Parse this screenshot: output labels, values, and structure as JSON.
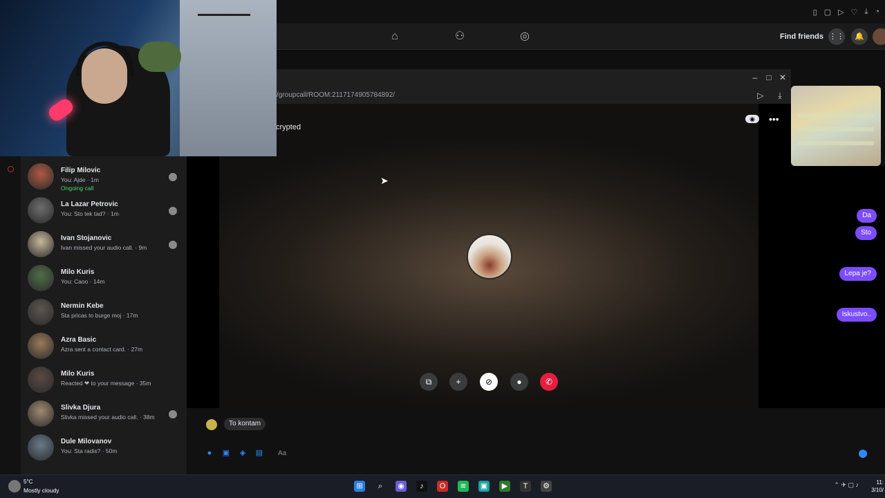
{
  "browser": {
    "url_fragment": "/groupcall/ROOM:2117174905784892/"
  },
  "fb_nav": {
    "find_friends_label": "Find friends"
  },
  "call": {
    "encryption_label": "crypted",
    "controls": [
      {
        "name": "share-screen-button",
        "glyph": "⧉"
      },
      {
        "name": "add-person-button",
        "glyph": "👤"
      },
      {
        "name": "video-off-button",
        "glyph": "⊘"
      },
      {
        "name": "microphone-button",
        "glyph": "🎤"
      },
      {
        "name": "end-call-button",
        "glyph": "✆"
      }
    ]
  },
  "chat_list": [
    {
      "name": "Filip Milovic",
      "preview": "You: Ajde · 1m",
      "extra": "Ongoing call",
      "avatar_color": "#b05a44"
    },
    {
      "name": "La Lazar Petrovic",
      "preview": "You: Sto tek tad? · 1m",
      "extra": "",
      "avatar_color": "#6d6d6d"
    },
    {
      "name": "Ivan Stojanovic",
      "preview": "Ivan missed your audio call. · 9m",
      "extra": "",
      "avatar_color": "#c8b79a"
    },
    {
      "name": "Milo Kuris",
      "preview": "You: Caoo · 14m",
      "extra": "",
      "avatar_color": "#4f6e48"
    },
    {
      "name": "Nermin Kebe",
      "preview": "Sta pricas to burge moj · 17m",
      "extra": "",
      "avatar_color": "#5d5550"
    },
    {
      "name": "Azra Basic",
      "preview": "Azra sent a contact card. · 27m",
      "extra": "",
      "avatar_color": "#9a7a5a"
    },
    {
      "name": "Milo Kuris",
      "preview": "Reacted ❤ to your message · 35m",
      "extra": "",
      "avatar_color": "#5a4a42"
    },
    {
      "name": "Slivka Djura",
      "preview": "Slivka missed your audio call. · 38m",
      "extra": "",
      "avatar_color": "#a08a70"
    },
    {
      "name": "Dule Milovanov",
      "preview": "You: Sta radis? · 50m",
      "extra": "",
      "avatar_color": "#6a7a8a"
    }
  ],
  "right_chat": {
    "bubbles": [
      "Da",
      "Sto",
      "Lepa je?",
      "Iskustvo.."
    ]
  },
  "conversation": {
    "last_message": "To kontam",
    "input_placeholder": "Aa"
  },
  "taskbar": {
    "temperature": "5°C",
    "weather": "Mostly cloudy",
    "time": "11:",
    "date": "3/10/"
  },
  "colors": {
    "accent": "#7b4dff",
    "messenger_blue": "#2e89ff",
    "end_call": "#e41e3f"
  }
}
